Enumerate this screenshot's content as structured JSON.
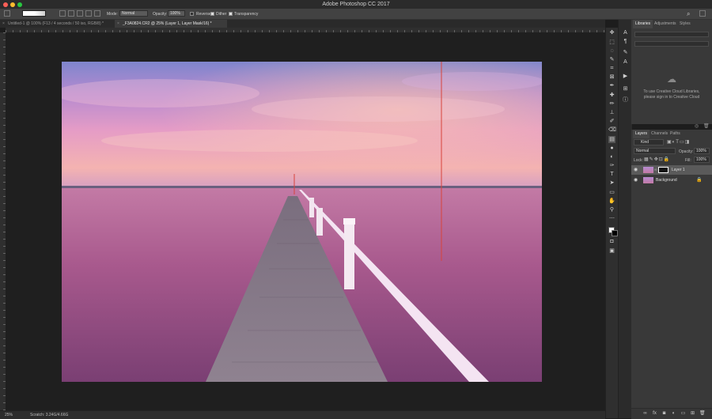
{
  "app": {
    "title": "Adobe Photoshop CC 2017"
  },
  "options_bar": {
    "mode_label": "Mode:",
    "mode_value": "Normal",
    "opacity_label": "Opacity:",
    "opacity_value": "100%",
    "reverse_label": "Reverse",
    "dither_label": "Dither",
    "transparency_label": "Transparency",
    "search_icon": "search-icon",
    "workspace_icon": "workspace-icon"
  },
  "tabs": [
    {
      "label": "Untitled-1 @ 100% (F13 / 4 seconds / 50 iso, RGB/8) *",
      "active": false
    },
    {
      "label": "_F3A0824.CR2 @ 25% (Layer 1, Layer Mask/16) *",
      "active": true
    }
  ],
  "status": {
    "zoom": "25%",
    "scratch": "Scratch: 3.24G/4.66G"
  },
  "libraries": {
    "tabs": [
      "Libraries",
      "Adjustments",
      "Styles"
    ],
    "message_line1": "To use Creative Cloud Libraries,",
    "message_line2": "please sign in to Creative Cloud"
  },
  "layers_panel": {
    "tabs": [
      "Layers",
      "Channels",
      "Paths"
    ],
    "filter_kind": "Kind",
    "blend_mode": "Normal",
    "opacity_label": "Opacity:",
    "opacity_value": "100%",
    "lock_label": "Lock:",
    "fill_label": "Fill:",
    "fill_value": "100%",
    "layers": [
      {
        "name": "Layer 1",
        "selected": true
      },
      {
        "name": "Background",
        "selected": false
      }
    ]
  },
  "colors": {
    "accent_guide": "#d8433c",
    "selected_layer": "#5a5a5a",
    "sky_top": "#8c83c9",
    "horizon": "#f0b0a8",
    "water": "#9c4f82"
  }
}
